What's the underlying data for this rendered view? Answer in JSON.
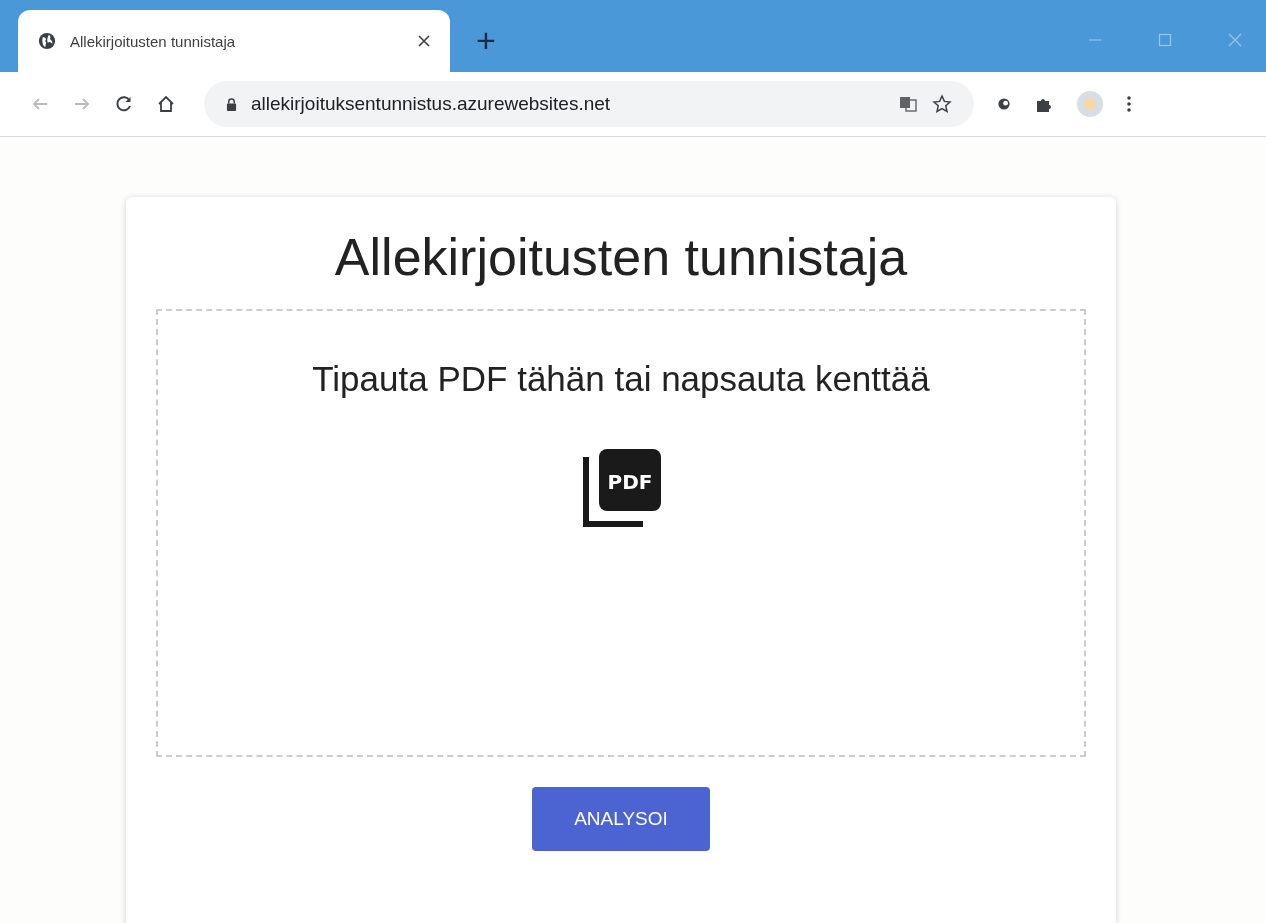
{
  "browser": {
    "tab": {
      "title": "Allekirjoitusten tunnistaja",
      "selected": true
    },
    "new_tab": "+",
    "address": "allekirjoituksentunnistus.azurewebsites.net"
  },
  "page": {
    "title": "Allekirjoitusten tunnistaja",
    "drop_zone": {
      "prompt": "Tipauta PDF tähän tai napsauta kenttää",
      "icon_text": "PDF"
    },
    "button": "ANALYSOI"
  }
}
